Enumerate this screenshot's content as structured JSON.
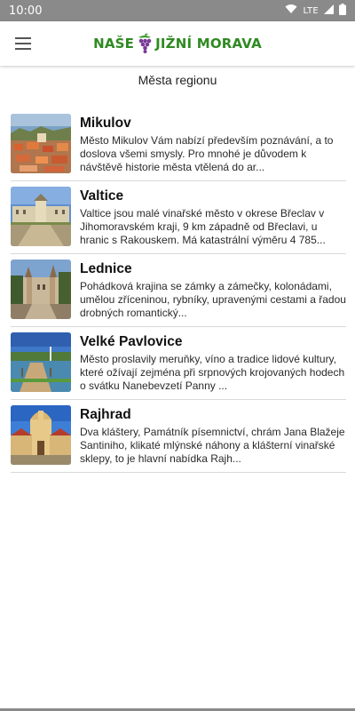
{
  "status_bar": {
    "time": "10:00",
    "network": "LTE",
    "icons": [
      "wifi-icon",
      "signal-icon",
      "battery-icon"
    ]
  },
  "app_bar": {
    "menu_icon": "hamburger-menu-icon",
    "logo": {
      "text_left": "NAŠE",
      "text_right": "JIŽNÍ MORAVA",
      "icon": "grape-icon",
      "color": "#2f8a22"
    }
  },
  "section": {
    "title": "Města regionu"
  },
  "towns": [
    {
      "name": "Mikulov",
      "description": "Město Mikulov Vám nabízí především poznávání, a to doslova všemi smysly. Pro mnohé je důvodem k návštěvě historie města vtělená do ar..."
    },
    {
      "name": "Valtice",
      "description": "Valtice jsou malé vinařské město v okrese Břeclav v Jihomoravském kraji, 9 km západně od Břeclavi, u hranic s Rakouskem. Má katastrální výměru 4 785..."
    },
    {
      "name": "Lednice",
      "description": "Pohádková krajina se zámky a zámečky, kolonádami, umělou zříceninou, rybníky, upravenými cestami a řadou drobných romantický..."
    },
    {
      "name": "Velké Pavlovice",
      "description": "Město proslavily meruňky, víno a tradice lidové kultury, které ožívají zejména při srpnových krojovaných hodech o svátku Nanebevzetí Panny ..."
    },
    {
      "name": "Rajhrad",
      "description": "Dva kláštery, Památník písemnictví, chrám Jana Blažeje Santiniho, klikaté mlýnské náhony a klášterní vinařské sklepy, to je hlavní nabídka Rajh..."
    }
  ]
}
